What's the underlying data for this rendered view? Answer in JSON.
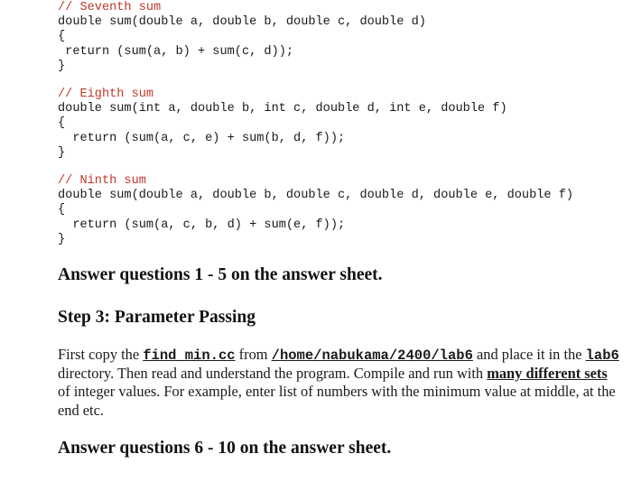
{
  "code_blocks": [
    {
      "comment": "// Seventh sum",
      "signature": "double sum(double a, double b, double c, double d)",
      "open_brace": "{",
      "body": " return (sum(a, b) + sum(c, d));",
      "close_brace": "}"
    },
    {
      "comment": "// Eighth sum",
      "signature": "double sum(int a, double b, int c, double d, int e, double f)",
      "open_brace": "{",
      "body": "  return (sum(a, c, e) + sum(b, d, f));",
      "close_brace": "}"
    },
    {
      "comment": "// Ninth sum",
      "signature": "double sum(double a, double b, double c, double d, double e, double f)",
      "open_brace": "{",
      "body": "  return (sum(a, c, b, d) + sum(e, f));",
      "close_brace": "}"
    }
  ],
  "answer_1": "Answer questions 1 - 5 on the answer sheet.",
  "step_3": "Step 3:  Parameter Passing",
  "paragraph": {
    "t1": "First copy the ",
    "file": "find_min.cc",
    "t2": " from ",
    "path": "/home/nabukama/2400/lab6",
    "t3": " and place it in the ",
    "dir": "lab6",
    "t4": " directory. Then read and understand the program. Compile and run with ",
    "emph": "many different sets",
    "t5": " of integer values. For example, enter list of numbers with the minimum value at middle, at the end etc."
  },
  "answer_2": "Answer questions 6 - 10 on the answer sheet.",
  "colors": {
    "comment": "#c0392b",
    "text": "#111111"
  }
}
